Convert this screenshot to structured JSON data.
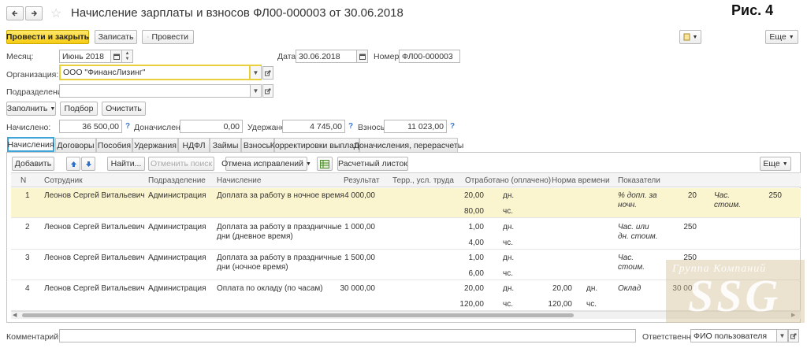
{
  "window": {
    "title": "Начисление зарплаты и взносов ФЛ00-000003 от 30.06.2018",
    "figure_label": "Рис. 4"
  },
  "toolbar": {
    "post_close": "Провести и закрыть",
    "save": "Записать",
    "post": "Провести",
    "more": "Еще"
  },
  "form": {
    "month_label": "Месяц:",
    "month_value": "Июнь 2018",
    "date_label": "Дата:",
    "date_value": "30.06.2018",
    "number_label": "Номер:",
    "number_value": "ФЛ00-000003",
    "org_label": "Организация:",
    "org_value": "ООО \"ФинансЛизинг\"",
    "dept_label": "Подразделение:",
    "dept_value": ""
  },
  "actions": {
    "fill": "Заполнить",
    "select": "Подбор",
    "clear": "Очистить"
  },
  "totals": {
    "accrued_label": "Начислено:",
    "accrued_value": "36 500,00",
    "extra_label": "Доначислено:",
    "extra_value": "0,00",
    "withheld_label": "Удержано:",
    "withheld_value": "4 745,00",
    "contrib_label": "Взносы:",
    "contrib_value": "11 023,00",
    "help": "?"
  },
  "tabs": [
    "Начисления",
    "Договоры",
    "Пособия",
    "Удержания",
    "НДФЛ",
    "Займы",
    "Взносы",
    "Корректировки выплаты",
    "Доначисления, перерасчеты"
  ],
  "table_toolbar": {
    "add": "Добавить",
    "find": "Найти...",
    "cancel_search": "Отменить поиск",
    "cancel_fix": "Отмена исправлений",
    "payslip": "Расчетный листок",
    "more": "Еще"
  },
  "columns": [
    "N",
    "Сотрудник",
    "Подразделение",
    "Начисление",
    "Результат",
    "Терр., усл. труда",
    "Отработано (оплачено)",
    "Норма времени",
    "Показатели"
  ],
  "rows": [
    {
      "n": "1",
      "employee": "Леонов Сергей Витальевич",
      "dept": "Администрация",
      "accrual": [
        "Доплата за работу в ночное время"
      ],
      "result": "4 000,00",
      "worked": [
        [
          "20,00",
          "дн."
        ],
        [
          "80,00",
          "чс."
        ]
      ],
      "norm": [],
      "ind1_name": [
        "% допл. за",
        "ночн."
      ],
      "ind1_val": "20",
      "ind2_name": [
        "Час.",
        "стоим."
      ],
      "ind2_val": "250"
    },
    {
      "n": "2",
      "employee": "Леонов Сергей Витальевич",
      "dept": "Администрация",
      "accrual": [
        "Доплата за работу в праздничные",
        "дни (дневное время)"
      ],
      "result": "1 000,00",
      "worked": [
        [
          "1,00",
          "дн."
        ],
        [
          "4,00",
          "чс."
        ]
      ],
      "norm": [],
      "ind1_name": [
        "Час. или",
        "дн. стоим."
      ],
      "ind1_val": "250",
      "ind2_name": [],
      "ind2_val": ""
    },
    {
      "n": "3",
      "employee": "Леонов Сергей Витальевич",
      "dept": "Администрация",
      "accrual": [
        "Доплата за работу в праздничные",
        "дни (ночное время)"
      ],
      "result": "1 500,00",
      "worked": [
        [
          "1,00",
          "дн."
        ],
        [
          "6,00",
          "чс."
        ]
      ],
      "norm": [],
      "ind1_name": [
        "Час.",
        "стоим."
      ],
      "ind1_val": "250",
      "ind2_name": [],
      "ind2_val": ""
    },
    {
      "n": "4",
      "employee": "Леонов Сергей Витальевич",
      "dept": "Администрация",
      "accrual": [
        "Оплата по окладу (по часам)"
      ],
      "result": "30 000,00",
      "worked": [
        [
          "20,00",
          "дн."
        ],
        [
          "120,00",
          "чс."
        ]
      ],
      "norm": [
        [
          "20,00",
          "дн."
        ],
        [
          "120,00",
          "чс."
        ]
      ],
      "ind1_name": [
        "Оклад"
      ],
      "ind1_val": "30 000",
      "ind2_name": [],
      "ind2_val": ""
    }
  ],
  "footer": {
    "comment_label": "Комментарий:",
    "comment_value": "",
    "responsible_label": "Ответственный:",
    "responsible_value": "ФИО пользователя"
  },
  "watermark": {
    "line1": "Группа Компаний",
    "line2": "SSG"
  },
  "colors": {
    "primary_button": "#f6cc14",
    "selected_row": "#fbf5cf",
    "active_tab_border": "#3fa5d9",
    "link_blue": "#3a7bd5"
  }
}
